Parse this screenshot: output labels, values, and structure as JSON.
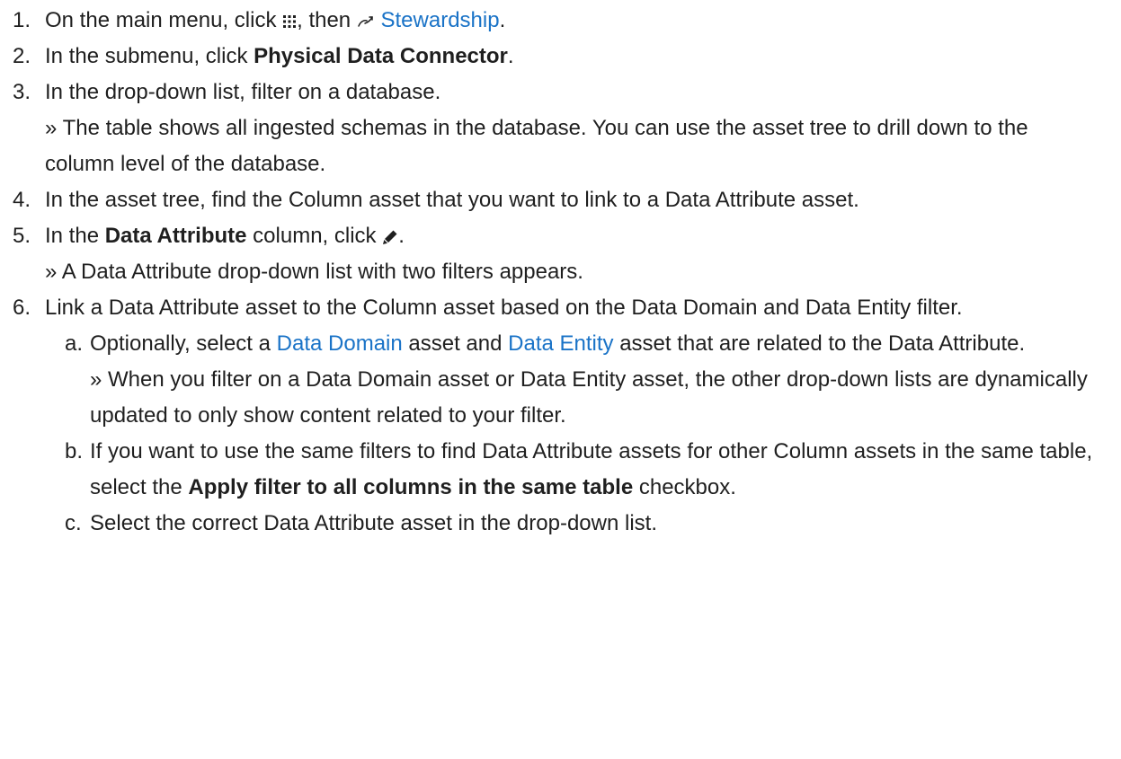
{
  "steps": [
    {
      "num": "1.",
      "t1": "On the main menu, click ",
      "icon1": "grid-menu-icon",
      "t2": ", then ",
      "icon2": "stewardship-icon",
      "link": "Stewardship",
      "t3": "."
    },
    {
      "num": "2.",
      "t1": "In the submenu, click ",
      "bold": "Physical Data Connector",
      "t2": "."
    },
    {
      "num": "3.",
      "t1": "In the drop-down list, filter on a database.",
      "result": "» The table shows all ingested schemas in the database. You can use the asset tree to drill down to the column level of the database."
    },
    {
      "num": "4.",
      "t1": "In the asset tree, find the Column asset that you want to link to a Data Attribute asset."
    },
    {
      "num": "5.",
      "t1": "In the ",
      "bold": "Data Attribute",
      "t2": " column, click ",
      "icon1": "pencil-icon",
      "t3": ".",
      "result": "» A Data Attribute drop-down list with two filters appears."
    },
    {
      "num": "6.",
      "t1": "Link a Data Attribute asset to the Column asset based on the Data Domain and Data Entity filter."
    }
  ],
  "substeps": [
    {
      "letter": "a.",
      "t1": "Optionally, select a ",
      "link1": "Data Domain",
      "t2": " asset and ",
      "link2": "Data Entity",
      "t3": " asset that are related to the Data Attribute.",
      "result": "» When you filter on a Data Domain asset or Data Entity asset, the other drop-down lists are dynamically updated to only show content related to your filter."
    },
    {
      "letter": "b.",
      "t1": "If you want to use the same filters to find Data Attribute assets for other Column assets in the same table, select the ",
      "bold": "Apply filter to all columns in the same table",
      "t2": " checkbox."
    },
    {
      "letter": "c.",
      "t1": "Select the correct Data Attribute asset in the drop-down list."
    }
  ],
  "colors": {
    "text": "#1f1f1f",
    "link": "#1a73c7"
  }
}
